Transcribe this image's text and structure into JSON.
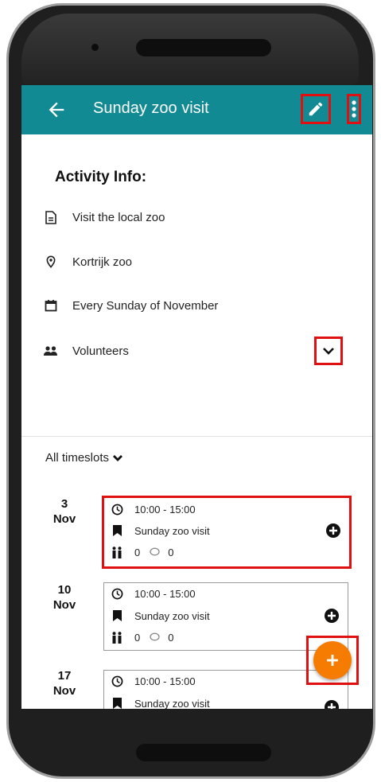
{
  "appbar": {
    "title": "Sunday zoo visit"
  },
  "info": {
    "heading": "Activity Info:",
    "description": "Visit the local zoo",
    "location": "Kortrijk zoo",
    "schedule": "Every Sunday of November",
    "volunteers": "Volunteers"
  },
  "timeslots": {
    "filter_label": "All timeslots",
    "items": [
      {
        "day": "3",
        "month": "Nov",
        "time": "10:00 - 15:00",
        "name": "Sunday zoo visit",
        "count_a": "0",
        "count_b": "0"
      },
      {
        "day": "10",
        "month": "Nov",
        "time": "10:00 - 15:00",
        "name": "Sunday zoo visit",
        "count_a": "0",
        "count_b": "0"
      },
      {
        "day": "17",
        "month": "Nov",
        "time": "10:00 - 15:00",
        "name": "Sunday zoo visit"
      }
    ]
  },
  "colors": {
    "appbar": "#118a93",
    "fab": "#f57c00",
    "highlight": "#e01010"
  }
}
